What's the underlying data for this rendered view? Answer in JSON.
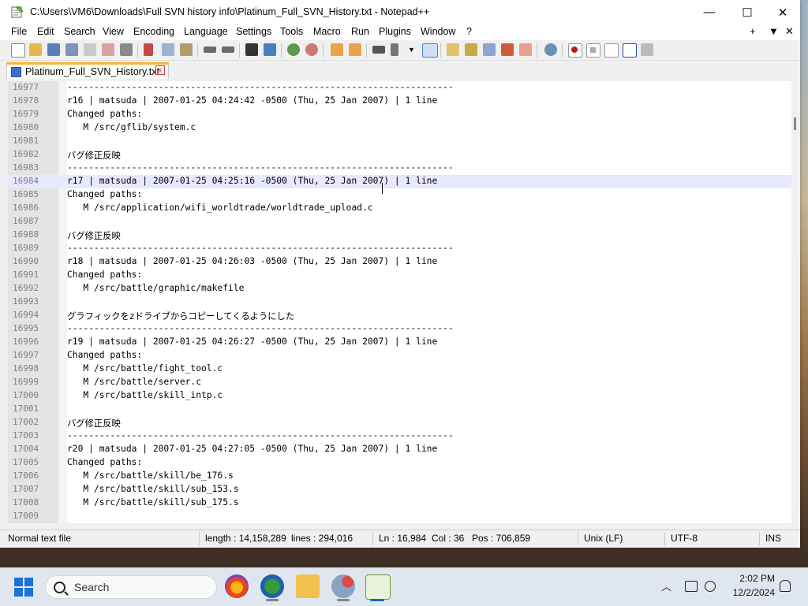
{
  "window": {
    "title": "C:\\Users\\VM6\\Downloads\\Full SVN history info\\Platinum_Full_SVN_History.txt - Notepad++",
    "minimize_glyph": "—",
    "maximize_glyph": "☐",
    "close_glyph": "✕"
  },
  "menu": {
    "items": [
      "File",
      "Edit",
      "Search",
      "View",
      "Encoding",
      "Language",
      "Settings",
      "Tools",
      "Macro",
      "Run",
      "Plugins",
      "Window",
      "?"
    ],
    "right_plus": "+",
    "right_down": "▼",
    "right_close": "✕"
  },
  "tab": {
    "label": "Platinum_Full_SVN_History.txt",
    "close_glyph": "x"
  },
  "editor": {
    "lines": [
      {
        "num": "16977",
        "text": "------------------------------------------------------------------------"
      },
      {
        "num": "16978",
        "text": "r16 | matsuda | 2007-01-25 04:24:42 -0500 (Thu, 25 Jan 2007) | 1 line"
      },
      {
        "num": "16979",
        "text": "Changed paths:"
      },
      {
        "num": "16980",
        "text": "   M /src/gflib/system.c"
      },
      {
        "num": "16981",
        "text": ""
      },
      {
        "num": "16982",
        "text": "バグ修正反映"
      },
      {
        "num": "16983",
        "text": "------------------------------------------------------------------------"
      },
      {
        "num": "16984",
        "text": "r17 | matsuda | 2007-01-25 04:25:16 -0500 (Thu, 25 Jan 2007) | 1 line"
      },
      {
        "num": "16985",
        "text": "Changed paths:"
      },
      {
        "num": "16986",
        "text": "   M /src/application/wifi_worldtrade/worldtrade_upload.c"
      },
      {
        "num": "16987",
        "text": ""
      },
      {
        "num": "16988",
        "text": "バグ修正反映"
      },
      {
        "num": "16989",
        "text": "------------------------------------------------------------------------"
      },
      {
        "num": "16990",
        "text": "r18 | matsuda | 2007-01-25 04:26:03 -0500 (Thu, 25 Jan 2007) | 1 line"
      },
      {
        "num": "16991",
        "text": "Changed paths:"
      },
      {
        "num": "16992",
        "text": "   M /src/battle/graphic/makefile"
      },
      {
        "num": "16993",
        "text": ""
      },
      {
        "num": "16994",
        "text": "グラフィックをzドライブからコピーしてくるようにした"
      },
      {
        "num": "16995",
        "text": "------------------------------------------------------------------------"
      },
      {
        "num": "16996",
        "text": "r19 | matsuda | 2007-01-25 04:26:27 -0500 (Thu, 25 Jan 2007) | 1 line"
      },
      {
        "num": "16997",
        "text": "Changed paths:"
      },
      {
        "num": "16998",
        "text": "   M /src/battle/fight_tool.c"
      },
      {
        "num": "16999",
        "text": "   M /src/battle/server.c"
      },
      {
        "num": "17000",
        "text": "   M /src/battle/skill_intp.c"
      },
      {
        "num": "17001",
        "text": ""
      },
      {
        "num": "17002",
        "text": "バグ修正反映"
      },
      {
        "num": "17003",
        "text": "------------------------------------------------------------------------"
      },
      {
        "num": "17004",
        "text": "r20 | matsuda | 2007-01-25 04:27:05 -0500 (Thu, 25 Jan 2007) | 1 line"
      },
      {
        "num": "17005",
        "text": "Changed paths:"
      },
      {
        "num": "17006",
        "text": "   M /src/battle/skill/be_176.s"
      },
      {
        "num": "17007",
        "text": "   M /src/battle/skill/sub_153.s"
      },
      {
        "num": "17008",
        "text": "   M /src/battle/skill/sub_175.s"
      },
      {
        "num": "17009",
        "text": ""
      }
    ],
    "current_line": "16984"
  },
  "status": {
    "type": "Normal text file",
    "length": "length : 14,158,289",
    "lines": "lines : 294,016",
    "ln": "Ln : 16,984",
    "col": "Col : 36",
    "pos": "Pos : 706,859",
    "eol": "Unix (LF)",
    "encoding": "UTF-8",
    "mode": "INS"
  },
  "taskbar": {
    "search_label": "Search",
    "chevron": "︿",
    "time": "2:02 PM",
    "date": "12/2/2024"
  },
  "colors": {
    "current_line": "#e8e8ff",
    "tab_accent": "#fab432",
    "gutter": "#e4e4e4"
  }
}
